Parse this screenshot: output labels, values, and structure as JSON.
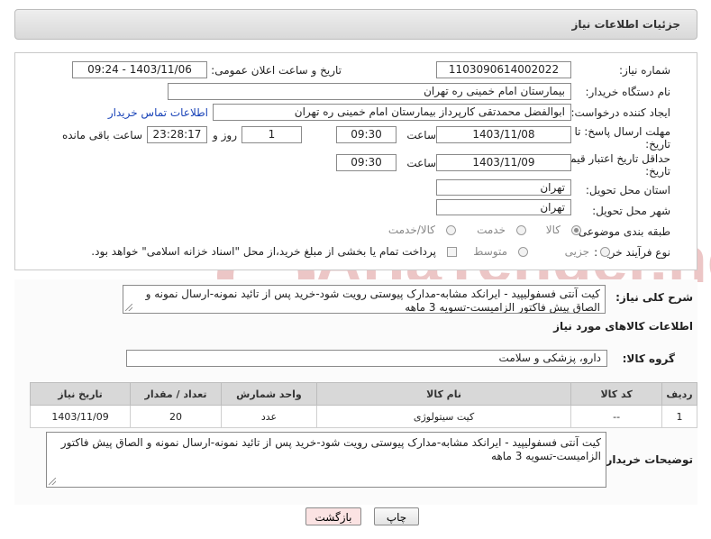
{
  "panel": {
    "title": "جزئیات اطلاعات نیاز"
  },
  "form": {
    "need_number": {
      "label": "شماره نیاز:",
      "value": "1103090614002022"
    },
    "announce_datetime": {
      "label": "تاریخ و ساعت اعلان عمومی:",
      "value": "1403/11/06 - 09:24"
    },
    "buyer_org": {
      "label": "نام دستگاه خریدار:",
      "value": "بیمارستان امام خمینی ره  تهران"
    },
    "requester": {
      "label": "ایجاد کننده درخواست:",
      "value": "ابوالفضل محمدتقی کارپرداز بیمارستان امام خمینی ره  تهران",
      "contact_link": "اطلاعات تماس خریدار"
    },
    "reply_deadline": {
      "label_line1": "مهلت ارسال پاسخ: تا",
      "label_line2": "تاریخ:",
      "date": "1403/11/08",
      "time_label": "ساعت",
      "time": "09:30",
      "days": "1",
      "days_label": "روز و",
      "remaining": "23:28:17",
      "remaining_label": "ساعت باقی مانده"
    },
    "price_validity": {
      "label_line1": "حداقل تاریخ اعتبار قیمت: تا",
      "label_line2": "تاریخ:",
      "date": "1403/11/09",
      "time_label": "ساعت",
      "time": "09:30"
    },
    "delivery_province": {
      "label": "استان محل تحویل:",
      "value": "تهران"
    },
    "delivery_city": {
      "label": "شهر محل تحویل:",
      "value": "تهران"
    },
    "category": {
      "label": "طبقه بندی موضوعی:",
      "options": [
        "کالا",
        "خدمت",
        "کالا/خدمت"
      ],
      "selected": "کالا"
    },
    "purchase_process": {
      "label": "نوع فرآیند خرید :",
      "options": [
        "جزیی",
        "متوسط"
      ],
      "selected": "جزیی",
      "treasury_note": "پرداخت تمام یا بخشی از مبلغ خرید،از محل \"اسناد خزانه اسلامی\" خواهد بود."
    }
  },
  "summary": {
    "label": "شرح کلی نیاز:",
    "text": "کیت آنتی فسفولیپید - ایرانکد مشابه-مدارک پیوستی رویت شود-خرید پس از تائید نمونه-ارسال نمونه و الصاق پیش فاکتور الزامیست-تسویه 3 ماهه"
  },
  "goods": {
    "title": "اطلاعات کالاهای مورد نیاز",
    "group_label": "گروه کالا:",
    "group_value": "دارو، پزشکی و سلامت",
    "table": {
      "headers": [
        "ردیف",
        "کد کالا",
        "نام کالا",
        "واحد شمارش",
        "تعداد / مقدار",
        "تاریخ نیاز"
      ],
      "rows": [
        [
          "1",
          "--",
          "کیت سیتولوژی",
          "عدد",
          "20",
          "1403/11/09"
        ]
      ]
    }
  },
  "buyer_notes": {
    "label": "توضیحات خریدار:",
    "text": "کیت آنتی فسفولیپید - ایرانکد مشابه-مدارک پیوستی رویت شود-خرید پس از تائید نمونه-ارسال نمونه و الصاق پیش فاکتور الزامیست-تسویه 3 ماهه"
  },
  "buttons": {
    "print": "چاپ",
    "back": "بازگشت"
  },
  "watermark": {
    "brand": "AriaTender.neT"
  },
  "colors": {
    "link": "#1a44b8",
    "back_button_bg": "#fbe3e3",
    "watermark": "#e7b9b9"
  }
}
